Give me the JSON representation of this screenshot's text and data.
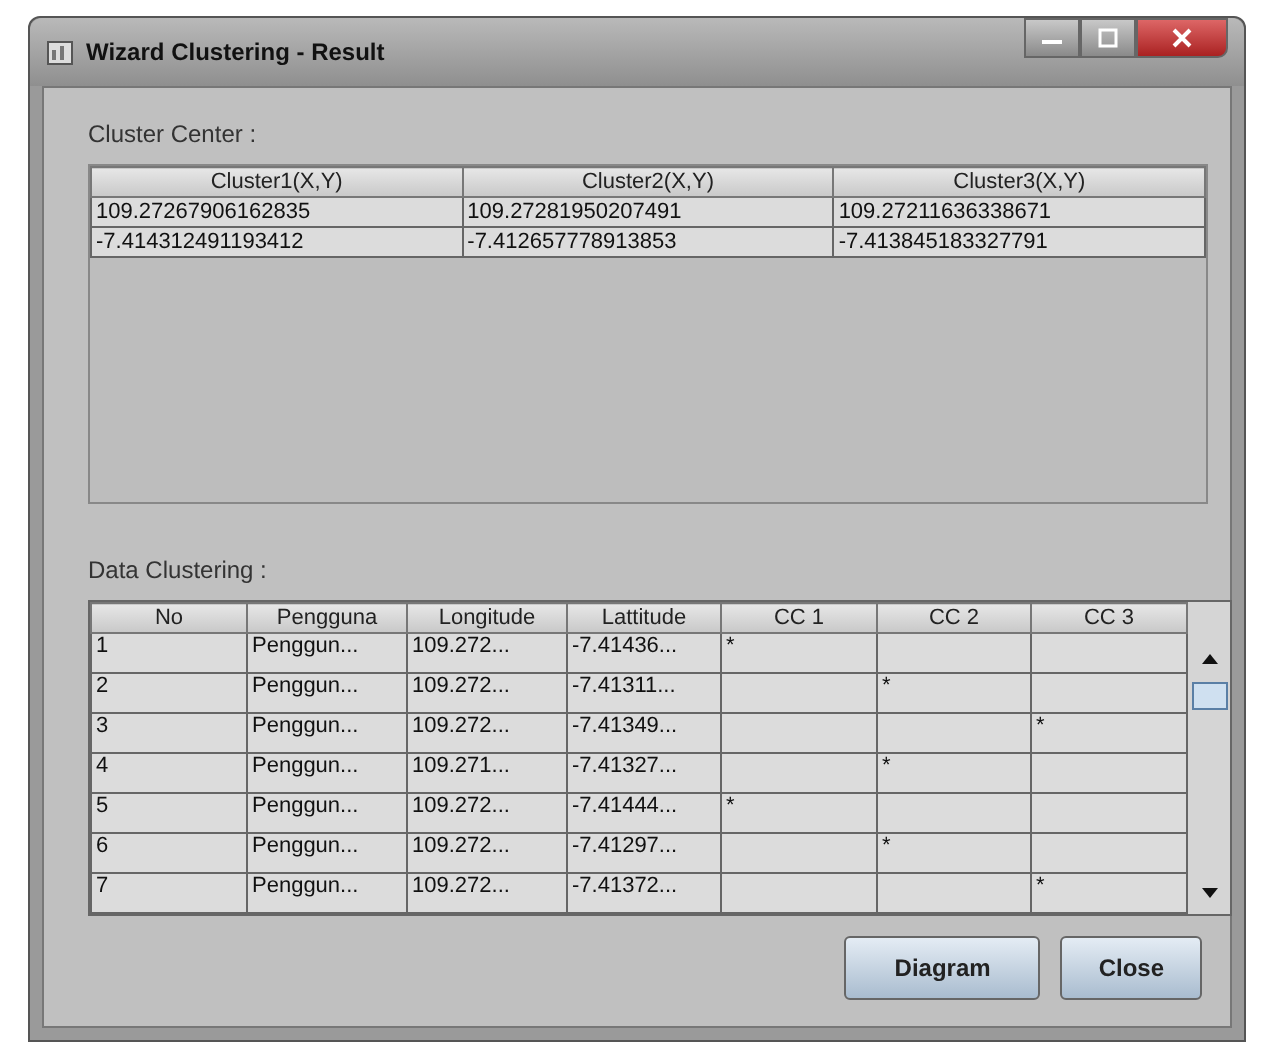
{
  "window": {
    "title": "Wizard Clustering - Result"
  },
  "cluster_center": {
    "label": "Cluster Center :",
    "columns": [
      "Cluster1(X,Y)",
      "Cluster2(X,Y)",
      "Cluster3(X,Y)"
    ],
    "rows": [
      [
        "109.27267906162835",
        "109.27281950207491",
        "109.27211636338671"
      ],
      [
        "-7.414312491193412",
        "-7.412657778913853",
        "-7.413845183327791"
      ]
    ]
  },
  "data_clustering": {
    "label": "Data Clustering :",
    "columns": [
      "No",
      "Pengguna",
      "Longitude",
      "Lattitude",
      "CC 1",
      "CC 2",
      "CC 3"
    ],
    "rows": [
      [
        "1",
        "Penggun...",
        "109.272...",
        "-7.41436...",
        "*",
        "",
        ""
      ],
      [
        "2",
        "Penggun...",
        "109.272...",
        "-7.41311...",
        "",
        "*",
        ""
      ],
      [
        "3",
        "Penggun...",
        "109.272...",
        "-7.41349...",
        "",
        "",
        "*"
      ],
      [
        "4",
        "Penggun...",
        "109.271...",
        "-7.41327...",
        "",
        "*",
        ""
      ],
      [
        "5",
        "Penggun...",
        "109.272...",
        "-7.41444...",
        "*",
        "",
        ""
      ],
      [
        "6",
        "Penggun...",
        "109.272...",
        "-7.41297...",
        "",
        "*",
        ""
      ],
      [
        "7",
        "Penggun...",
        "109.272...",
        "-7.41372...",
        "",
        "",
        "*"
      ]
    ]
  },
  "buttons": [
    "Diagram",
    "Close"
  ]
}
